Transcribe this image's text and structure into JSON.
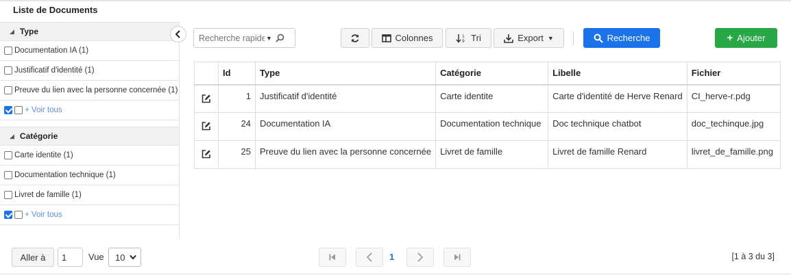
{
  "page": {
    "title": "Liste de Documents"
  },
  "facets": {
    "type": {
      "title": "Type",
      "items": [
        "Documentation IA (1)",
        "Justificatif d'identité (1)",
        "Preuve du lien avec la personne concernée (1)"
      ],
      "voir_tous": "+ Voir tous"
    },
    "categorie": {
      "title": "Catégorie",
      "items": [
        "Carte identite (1)",
        "Documentation technique (1)",
        "Livret de famille (1)"
      ],
      "voir_tous": "+ Voir tous"
    }
  },
  "toolbar": {
    "search_placeholder": "Recherche rapide",
    "colonnes_label": "Colonnes",
    "tri_label": "Tri",
    "export_label": "Export",
    "recherche_label": "Recherche",
    "ajouter_label": "Ajouter"
  },
  "table": {
    "columns": [
      "Id",
      "Type",
      "Catégorie",
      "Libelle",
      "Fichier"
    ],
    "rows": [
      {
        "id": "1",
        "type": "Justificatif d'identité",
        "categorie": "Carte identite",
        "libelle": "Carte d'identité de Herve Renard",
        "fichier": "CI_herve-r.pdg"
      },
      {
        "id": "24",
        "type": "Documentation IA",
        "categorie": "Documentation technique",
        "libelle": "Doc technique chatbot",
        "fichier": "doc_techinque.jpg"
      },
      {
        "id": "25",
        "type": "Preuve du lien avec la personne concernée",
        "categorie": "Livret de famille",
        "libelle": "Livret de famille Renard",
        "fichier": "livret_de_famille.png"
      }
    ]
  },
  "pagination": {
    "goto_label": "Aller à",
    "goto_value": "1",
    "vue_label": "Vue",
    "per_page": "10",
    "current_page": "1",
    "info": "[1 à 3 du 3]"
  },
  "colors": {
    "primary": "#1a73e8",
    "success": "#28a745"
  },
  "icons": {
    "toolbar": [
      "refresh-icon",
      "columns-icon",
      "sort-icon",
      "download-icon",
      "search-icon",
      "plus-icon"
    ],
    "row_action": "edit-icon",
    "pagination": [
      "first-page-icon",
      "prev-page-icon",
      "next-page-icon",
      "last-page-icon"
    ]
  }
}
